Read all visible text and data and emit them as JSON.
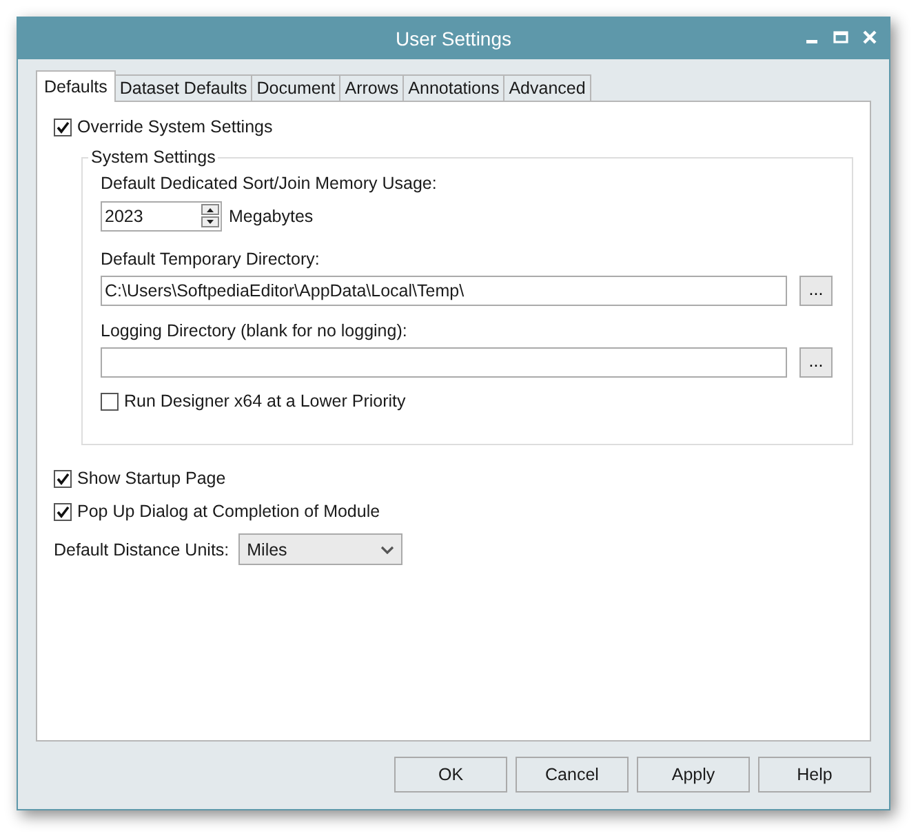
{
  "window": {
    "title": "User Settings"
  },
  "tabs": [
    {
      "label": "Defaults",
      "selected": true
    },
    {
      "label": "Dataset Defaults",
      "selected": false
    },
    {
      "label": "Document",
      "selected": false
    },
    {
      "label": "Arrows",
      "selected": false
    },
    {
      "label": "Annotations",
      "selected": false
    },
    {
      "label": "Advanced",
      "selected": false
    }
  ],
  "override": {
    "label": "Override System Settings",
    "checked": true
  },
  "system_settings": {
    "title": "System Settings",
    "memory": {
      "label": "Default Dedicated Sort/Join Memory Usage:",
      "value": "2023",
      "unit": "Megabytes"
    },
    "temp_directory": {
      "label": "Default Temporary Directory:",
      "value": "C:\\Users\\SoftpediaEditor\\AppData\\Local\\Temp\\",
      "browse": "..."
    },
    "logging_directory": {
      "label": "Logging Directory (blank for no logging):",
      "browse": "..."
    },
    "low_priority": {
      "label": "Run Designer x64 at a Lower Priority",
      "checked": false
    }
  },
  "options": [
    {
      "label": "Show Startup Page",
      "checked": true
    },
    {
      "label": "Pop Up Dialog at Completion of Module",
      "checked": true
    }
  ],
  "distance_units": {
    "label": "Default Distance Units:",
    "value": "Miles"
  },
  "buttons": [
    "OK",
    "Cancel",
    "Apply",
    "Help"
  ]
}
